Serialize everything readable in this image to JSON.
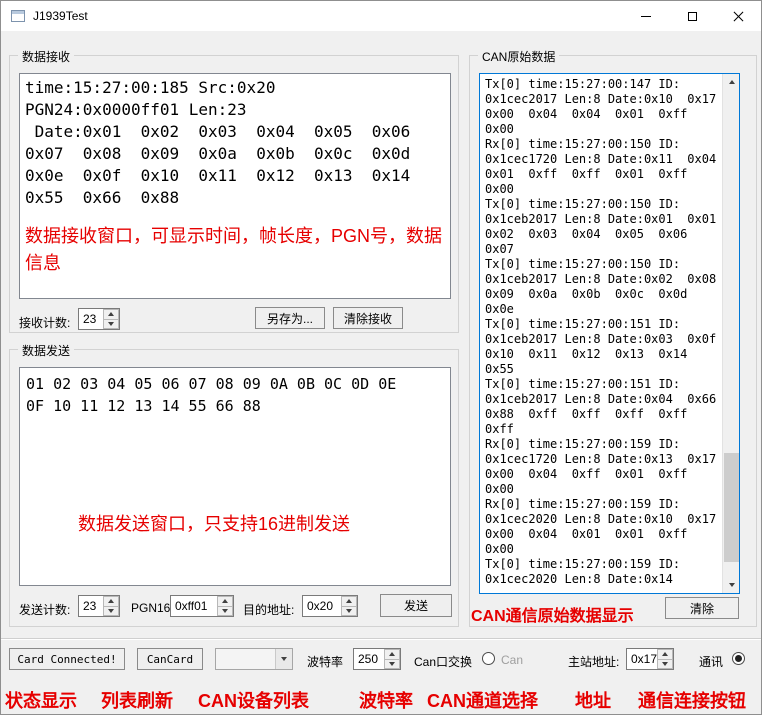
{
  "window": {
    "title": "J1939Test"
  },
  "colors": {
    "annotation_red": "#e60000",
    "focus_border": "#0078d7"
  },
  "receive": {
    "group_title": "数据接收",
    "lines": [
      "time:15:27:00:185 Src:0x20",
      "PGN24:0x0000ff01 Len:23",
      " Date:0x01  0x02  0x03  0x04  0x05  0x06",
      "0x07  0x08  0x09  0x0a  0x0b  0x0c  0x0d",
      "0x0e  0x0f  0x10  0x11  0x12  0x13  0x14",
      "0x55  0x66  0x88"
    ],
    "annotation": "数据接收窗口，可显示时间，帧长度，PGN号，数据信息",
    "count_label": "接收计数:",
    "count_value": "23",
    "save_as_button": "另存为...",
    "clear_button": "清除接收"
  },
  "send": {
    "group_title": "数据发送",
    "lines": [
      "01 02 03 04 05 06 07 08 09 0A 0B 0C 0D 0E",
      "0F 10 11 12 13 14 55 66 88"
    ],
    "annotation": "数据发送窗口，只支持16进制发送",
    "count_label": "发送计数:",
    "count_value": "23",
    "pgn_label": "PGN16",
    "pgn_value": "0xff01",
    "dest_label": "目的地址:",
    "dest_value": "0x20",
    "send_button": "发送"
  },
  "raw": {
    "group_title": "CAN原始数据",
    "lines": [
      "Tx[0] time:15:27:00:147 ID:",
      "0x1cec2017 Len:8 Date:0x10  0x17",
      "0x00  0x04  0x04  0x01  0xff",
      "0x00",
      "Rx[0] time:15:27:00:150 ID:",
      "0x1cec1720 Len:8 Date:0x11  0x04",
      "0x01  0xff  0xff  0x01  0xff",
      "0x00",
      "Tx[0] time:15:27:00:150 ID:",
      "0x1ceb2017 Len:8 Date:0x01  0x01",
      "0x02  0x03  0x04  0x05  0x06",
      "0x07",
      "Tx[0] time:15:27:00:150 ID:",
      "0x1ceb2017 Len:8 Date:0x02  0x08",
      "0x09  0x0a  0x0b  0x0c  0x0d",
      "0x0e",
      "Tx[0] time:15:27:00:151 ID:",
      "0x1ceb2017 Len:8 Date:0x03  0x0f",
      "0x10  0x11  0x12  0x13  0x14",
      "0x55",
      "Tx[0] time:15:27:00:151 ID:",
      "0x1ceb2017 Len:8 Date:0x04  0x66",
      "0x88  0xff  0xff  0xff  0xff",
      "0xff",
      "Rx[0] time:15:27:00:159 ID:",
      "0x1cec1720 Len:8 Date:0x13  0x17",
      "0x00  0x04  0xff  0x01  0xff",
      "0x00",
      "Rx[0] time:15:27:00:159 ID:",
      "0x1cec2020 Len:8 Date:0x10  0x17",
      "0x00  0x04  0x01  0x01  0xff",
      "0x00",
      "Tx[0] time:15:27:00:159 ID:",
      "0x1cec2020 Len:8 Date:0x14"
    ],
    "annotation": "CAN通信原始数据显示",
    "clear_button": "清除"
  },
  "bottom": {
    "status_button": "Card Connected!",
    "refresh_button": "CanCard",
    "device_list_value": "",
    "baud_label": "波特率",
    "baud_value": "250",
    "channel_label": "Can口交换",
    "channel_option": "Can",
    "master_label": "主站地址:",
    "master_value": "0x17",
    "comm_label": "通讯"
  },
  "annotations": {
    "status": "状态显示",
    "refresh": "列表刷新",
    "device_list": "CAN设备列表",
    "baud": "波特率",
    "channel": "CAN通道选择",
    "address": "地址",
    "connect": "通信连接按钮"
  }
}
